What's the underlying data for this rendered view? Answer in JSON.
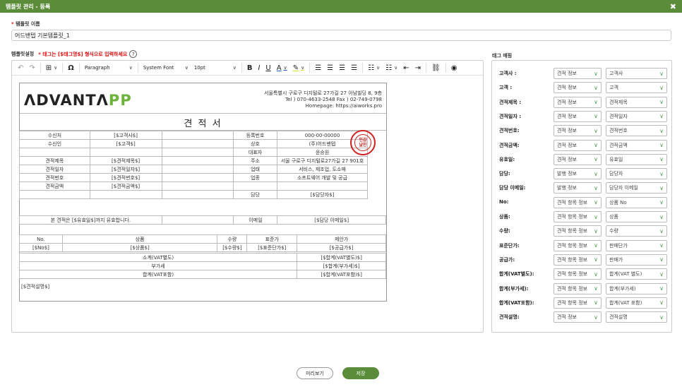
{
  "window": {
    "title": "템플릿 관리 - 등록"
  },
  "form": {
    "name_label": "템플릿 이름",
    "name_value": "어드밴텝 기본템플릿_1",
    "setting_label": "템플릿설정",
    "setting_hint": "* 태그는 [$태그명$] 형식으로 입력하세요",
    "help": "?"
  },
  "toolbar": {
    "block_format": "Paragraph",
    "font_family": "System Font",
    "font_size": "10pt"
  },
  "doc": {
    "logo_a": "ΛDVANTΛ",
    "logo_b": "PP",
    "address": [
      "서울특별시 구로구 디지털로 27가길 27 아남빌딩 8, 9층",
      "Tel ) 070-4633-2548 Fax ) 02-749-0798",
      "Homepage: https://aiworks.pro"
    ],
    "title": "견 적 서",
    "stamp": "인감\n날인",
    "rows": [
      [
        "수신처",
        "[$고객사$]",
        "",
        "등록번호",
        "000-00-00000"
      ],
      [
        "수신인",
        "[$고객$]",
        "",
        "상호",
        "(주)어드밴텝"
      ],
      [
        "",
        "",
        "",
        "대표자",
        "윤승원"
      ],
      [
        "견적제목",
        "[$견적제목$]",
        "",
        "주소",
        "서울 구로구 디지털로27가길 27 901호"
      ],
      [
        "견적일자",
        "[$견적일자$]",
        "",
        "업태",
        "서비스, 제조업, 도소매"
      ],
      [
        "견적번호",
        "[$견적번호$]",
        "",
        "업종",
        "소프트웨어 개발 및 공급"
      ],
      [
        "견적금액",
        "[$견적금액$]",
        "",
        "",
        ""
      ],
      [
        "",
        "",
        "",
        "담당",
        "[$담당자$]"
      ]
    ],
    "validity": "본 견적은 [$유효일$]까지 유효합니다.",
    "email_label": "이메일",
    "email_value": "[$담당 이메일$]",
    "item_header": [
      "No.",
      "상품",
      "수량",
      "표준가",
      "제안가"
    ],
    "item_row": [
      "[$No$]",
      "[$상품$]",
      "[$수량$]",
      "[$표준단가$]",
      "[$공급가$]"
    ],
    "totals": [
      [
        "소계(VAT별도)",
        "[$합계(VAT별도)$]"
      ],
      [
        "부가세",
        "[$합계(부가세)$]"
      ],
      [
        "합계(VAT포함)",
        "[$합계(VAT포함)$]"
      ]
    ],
    "memo": "[$견적설명$]"
  },
  "mapping": {
    "title": "태그 매핑",
    "rows": [
      {
        "label": "고객사 :",
        "a": "견적 정보",
        "b": "고객사"
      },
      {
        "label": "고객 :",
        "a": "견적 정보",
        "b": "고객"
      },
      {
        "label": "견적제목 :",
        "a": "견적 정보",
        "b": "견적제목"
      },
      {
        "label": "견적일자 :",
        "a": "견적 정보",
        "b": "견적일자"
      },
      {
        "label": "견적번호:",
        "a": "견적 정보",
        "b": "견적번호"
      },
      {
        "label": "견적금액:",
        "a": "견적 정보",
        "b": "견적금액"
      },
      {
        "label": "유효일:",
        "a": "견적 정보",
        "b": "유효일"
      },
      {
        "label": "담당:",
        "a": "발행 정보",
        "b": "담당자"
      },
      {
        "label": "담당 이메일:",
        "a": "발행 정보",
        "b": "담당자 이메일"
      },
      {
        "label": "No:",
        "a": "견적 항목 정보",
        "b": "상품 No"
      },
      {
        "label": "상품:",
        "a": "견적 항목 정보",
        "b": "상품"
      },
      {
        "label": "수량:",
        "a": "견적 항목 정보",
        "b": "수량"
      },
      {
        "label": "표준단가:",
        "a": "견적 항목 정보",
        "b": "판매단가"
      },
      {
        "label": "공급가:",
        "a": "견적 항목 정보",
        "b": "판매가"
      },
      {
        "label": "합계(VAT별도):",
        "a": "견적 항목 정보",
        "b": "합계(VAT 별도)"
      },
      {
        "label": "합계(부가세):",
        "a": "견적 항목 정보",
        "b": "합계(부가세)"
      },
      {
        "label": "합계(VAT포함):",
        "a": "견적 항목 정보",
        "b": "합계(VAT 포함)"
      },
      {
        "label": "견적설명:",
        "a": "견적 정보",
        "b": "견적설명"
      }
    ]
  },
  "buttons": {
    "preview": "미리보기",
    "save": "저장"
  },
  "colors": {
    "brand": "#5b8c3a",
    "required": "#e01010"
  }
}
